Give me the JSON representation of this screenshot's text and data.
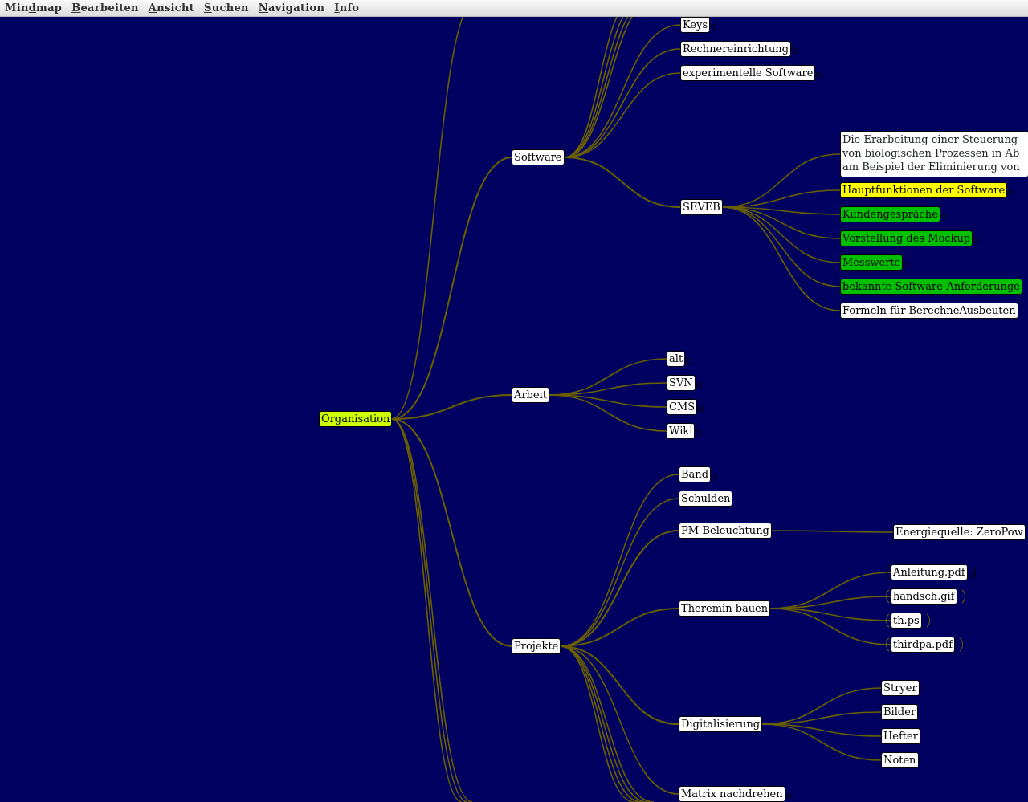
{
  "menu_bar": [
    {
      "prefix": "Min",
      "access_key": "d",
      "rest": "map"
    },
    {
      "access_key": "B",
      "rest": "earbeiten"
    },
    {
      "access_key": "A",
      "rest": "nsicht"
    },
    {
      "access_key": "S",
      "rest": "uchen"
    },
    {
      "access_key": "N",
      "rest": "avigation"
    },
    {
      "access_key": "I",
      "rest": "nfo"
    }
  ],
  "mindmap": {
    "root": {
      "text": "Organisation",
      "color": "#ccff00",
      "children": [
        {
          "text": "Software",
          "color": "#ffffff",
          "children": [
            {
              "text": "Keys",
              "color": "#ffffff",
              "folded": true
            },
            {
              "text": "Rechnereinrichtung",
              "color": "#ffffff",
              "folded": true
            },
            {
              "text": "experimentelle Software",
              "color": "#ffffff",
              "folded": true
            },
            {
              "text": "SEVEB",
              "color": "#ffffff",
              "children": [
                {
                  "kind": "note",
                  "color": "#ffffff",
                  "lines": [
                    "Die Erarbeitung einer Steuerung",
                    "von biologischen Prozessen in Ab",
                    "am Beispiel der Eliminierung von"
                  ]
                },
                {
                  "text": "Hauptfunktionen der Software",
                  "color": "#ffff00",
                  "folded": true
                },
                {
                  "text": "Kundengespräche",
                  "color": "#00c000",
                  "folded": true
                },
                {
                  "text": "Vorstellung des Mockup",
                  "color": "#00c000",
                  "folded": true
                },
                {
                  "text": "Messwerte",
                  "color": "#00c000",
                  "folded": true
                },
                {
                  "text": "bekannte Software-Anforderunge",
                  "color": "#00c000"
                },
                {
                  "text": "Formeln für BerechneAusbeuten",
                  "color": "#ffffff"
                }
              ]
            }
          ]
        },
        {
          "text": "Arbeit",
          "color": "#ffffff",
          "children": [
            {
              "text": "alt",
              "color": "#ffffff",
              "folded": true
            },
            {
              "text": "SVN",
              "color": "#ffffff",
              "folded": true
            },
            {
              "text": "CMS",
              "color": "#ffffff",
              "folded": true
            },
            {
              "text": "Wiki",
              "color": "#ffffff",
              "folded": true
            }
          ]
        },
        {
          "text": "Projekte",
          "color": "#ffffff",
          "children": [
            {
              "text": "Band",
              "color": "#ffffff",
              "folded": true
            },
            {
              "text": "Schulden",
              "color": "#ffffff"
            },
            {
              "text": "PM-Beleuchtung",
              "color": "#ffffff",
              "children": [
                {
                  "text": "Energiequelle: ZeroPow",
                  "color": "#ffffff"
                }
              ]
            },
            {
              "text": "Theremin bauen",
              "color": "#ffffff",
              "children": [
                {
                  "text": "Anleitung.pdf",
                  "color": "#ffffff",
                  "folded": true,
                  "linked": true
                },
                {
                  "text": "handsch.gif",
                  "color": "#ffffff",
                  "linked": true
                },
                {
                  "text": "th.ps",
                  "color": "#ffffff",
                  "linked": true
                },
                {
                  "text": "thirdpa.pdf",
                  "color": "#ffffff",
                  "linked": true
                }
              ]
            },
            {
              "text": "Digitalisierung",
              "color": "#ffffff",
              "children": [
                {
                  "text": "Stryer",
                  "color": "#ffffff"
                },
                {
                  "text": "Bilder",
                  "color": "#ffffff"
                },
                {
                  "text": "Hefter",
                  "color": "#ffffff"
                },
                {
                  "text": "Noten",
                  "color": "#ffffff"
                }
              ]
            },
            {
              "text": "Matrix nachdrehen",
              "color": "#ffffff",
              "folded": true
            }
          ]
        }
      ]
    }
  }
}
